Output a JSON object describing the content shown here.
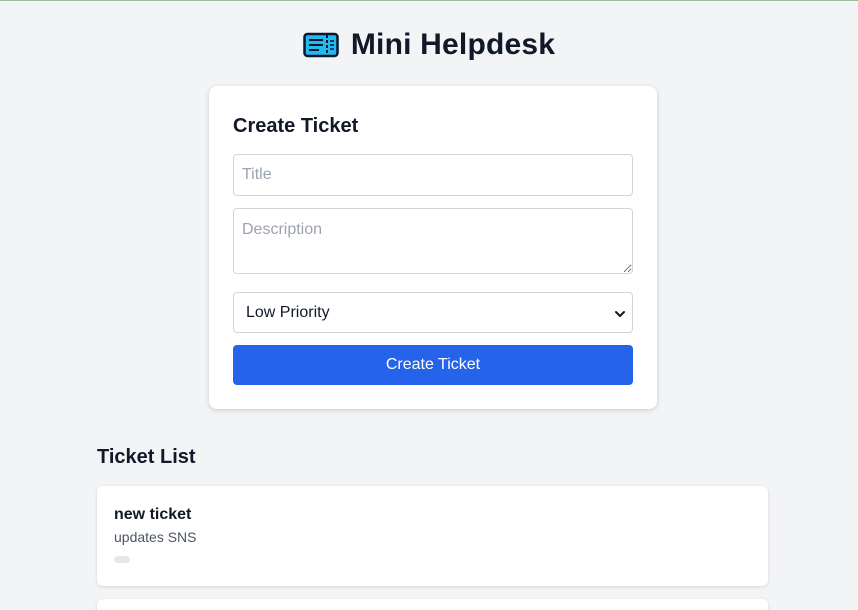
{
  "app": {
    "title": "Mini Helpdesk",
    "icon": "ticket-icon"
  },
  "form": {
    "heading": "Create Ticket",
    "title_placeholder": "Title",
    "title_value": "",
    "description_placeholder": "Description",
    "description_value": "",
    "priority_selected": "Low Priority",
    "submit_label": "Create Ticket"
  },
  "list": {
    "heading": "Ticket List",
    "tickets": [
      {
        "title": "new ticket",
        "description": "updates SNS",
        "badge": ""
      }
    ]
  },
  "colors": {
    "accent": "#2563eb",
    "background": "#f3f4f6",
    "card": "#ffffff",
    "icon_fill": "#22b8f0"
  }
}
